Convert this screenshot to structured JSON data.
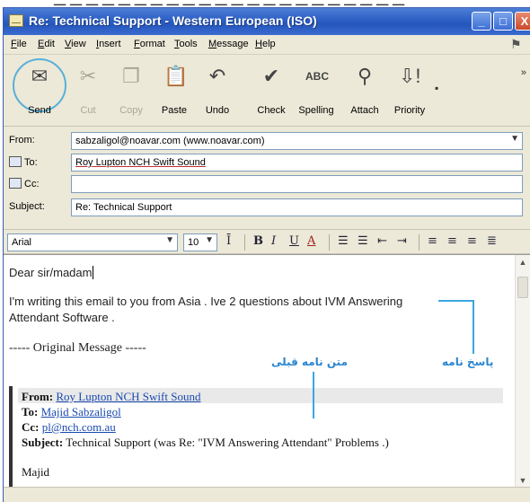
{
  "window": {
    "title": "Re: Technical Support - Western European (ISO)",
    "min_glyph": "_",
    "max_glyph": "□",
    "close_glyph": "X"
  },
  "menu": [
    "File",
    "Edit",
    "View",
    "Insert",
    "Format",
    "Tools",
    "Message",
    "Help"
  ],
  "toolbar": {
    "items": [
      {
        "label": "Send",
        "icon": "send-icon",
        "enabled": true
      },
      {
        "label": "Cut",
        "icon": "scissors-icon",
        "enabled": false
      },
      {
        "label": "Copy",
        "icon": "copy-icon",
        "enabled": false
      },
      {
        "label": "Paste",
        "icon": "paste-icon",
        "enabled": true
      },
      {
        "label": "Undo",
        "icon": "undo-icon",
        "enabled": true
      },
      {
        "label": "Check",
        "icon": "check-names-icon",
        "enabled": true
      },
      {
        "label": "Spelling",
        "icon": "spelling-icon",
        "enabled": true
      },
      {
        "label": "Attach",
        "icon": "paperclip-icon",
        "enabled": true
      },
      {
        "label": "Priority",
        "icon": "priority-icon",
        "enabled": true
      }
    ],
    "overflow_glyph": "»"
  },
  "header": {
    "from_label": "From:",
    "from_value": "sabzaligol@noavar.com   (www.noavar.com)",
    "to_label": "To:",
    "to_value": "Roy Lupton NCH Swift Sound",
    "cc_label": "Cc:",
    "cc_value": "",
    "subject_label": "Subject:",
    "subject_value": "Re: Technical Support"
  },
  "format": {
    "font": "Arial",
    "size": "10"
  },
  "body": {
    "greeting": "Dear sir/madam",
    "line1": "I'm writing this email to you from Asia . Ive 2 questions about IVM Answering",
    "line2": "Attendant Software .",
    "original": "----- Original Message -----",
    "q_from_label": "From:",
    "q_from": "Roy Lupton NCH Swift Sound",
    "q_to_label": "To:",
    "q_to": "Majid Sabzaligol",
    "q_cc_label": "Cc:",
    "q_cc": "pl@nch.com.au",
    "q_subject_label": "Subject:",
    "q_subject": "Technical Support (was Re: \"IVM Answering Attendant\" Problems .)",
    "q_sign": "Majid"
  },
  "annotations": {
    "reply": "پاسخ نامه",
    "previous": "متن نامه قبلی"
  },
  "colors": {
    "titlebar": "#2f62c6",
    "annotation": "#3aa6e0",
    "link": "#1a4ab0"
  }
}
